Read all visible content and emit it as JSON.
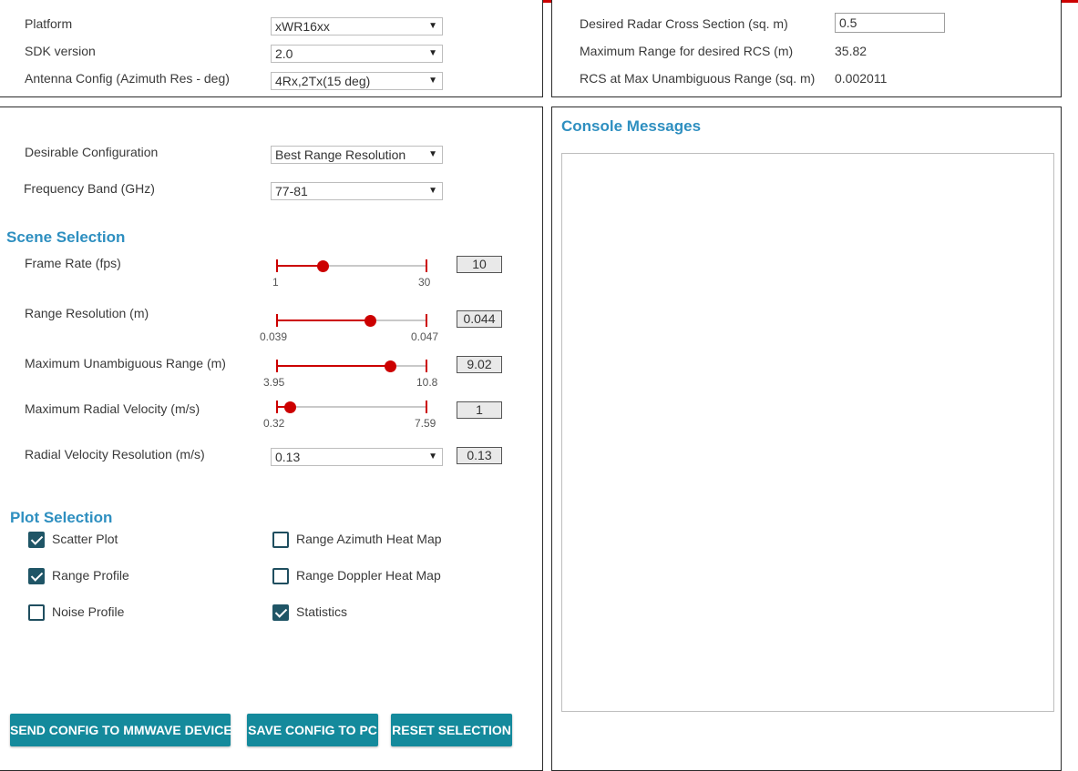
{
  "setup": {
    "platform_label": "Platform",
    "platform_value": "xWR16xx",
    "sdk_label": "SDK version",
    "sdk_value": "2.0",
    "antenna_label": "Antenna Config (Azimuth Res - deg)",
    "antenna_value": "4Rx,2Tx(15 deg)"
  },
  "rcs": {
    "desired_label": "Desired Radar Cross Section (sq. m)",
    "desired_value": "0.5",
    "max_range_label": "Maximum Range for desired RCS (m)",
    "max_range_value": "35.82",
    "rcs_at_max_label": "RCS at Max Unambiguous Range (sq. m)",
    "rcs_at_max_value": "0.002011"
  },
  "config": {
    "desirable_label": "Desirable Configuration",
    "desirable_value": "Best Range Resolution",
    "freq_label": "Frequency Band (GHz)",
    "freq_value": "77-81"
  },
  "scene": {
    "title": "Scene Selection",
    "frame_rate": {
      "label": "Frame Rate (fps)",
      "min": "1",
      "max": "30",
      "value": "10",
      "fraction": 0.31
    },
    "range_res": {
      "label": "Range Resolution (m)",
      "min": "0.039",
      "max": "0.047",
      "value": "0.044",
      "fraction": 0.63
    },
    "max_range": {
      "label": "Maximum Unambiguous Range (m)",
      "min": "3.95",
      "max": "10.8",
      "value": "9.02",
      "fraction": 0.76
    },
    "max_velocity": {
      "label": "Maximum Radial Velocity (m/s)",
      "min": "0.32",
      "max": "7.59",
      "value": "1",
      "fraction": 0.09
    },
    "vel_res": {
      "label": "Radial Velocity Resolution (m/s)",
      "select_value": "0.13",
      "readout": "0.13"
    }
  },
  "plots": {
    "title": "Plot Selection",
    "scatter": {
      "label": "Scatter Plot",
      "checked": true
    },
    "range_profile": {
      "label": "Range Profile",
      "checked": true
    },
    "noise_profile": {
      "label": "Noise Profile",
      "checked": false
    },
    "range_azimuth": {
      "label": "Range Azimuth Heat Map",
      "checked": false
    },
    "range_doppler": {
      "label": "Range Doppler Heat Map",
      "checked": false
    },
    "statistics": {
      "label": "Statistics",
      "checked": true
    }
  },
  "buttons": {
    "send": "SEND CONFIG TO MMWAVE DEVICE",
    "save": "SAVE CONFIG TO PC",
    "reset": "RESET SELECTION"
  },
  "console": {
    "title": "Console Messages"
  },
  "colors": {
    "accent_title": "#2e8fc0",
    "slider": "#cc0000",
    "button": "#148a9c",
    "checkbox": "#1f5566"
  }
}
